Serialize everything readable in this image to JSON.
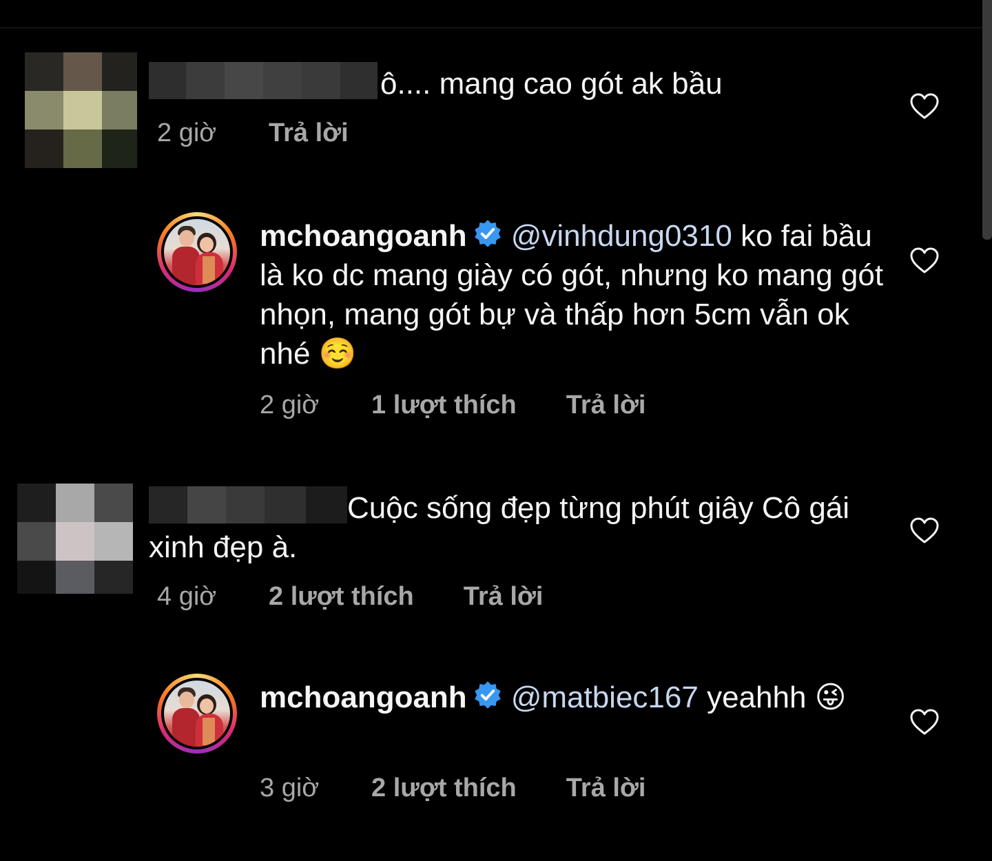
{
  "comments": [
    {
      "text": "ô.... mang cao gót ak bầu",
      "time": "2 giờ",
      "reply": "Trả lời",
      "reply_to": {
        "username": "mchoangoanh",
        "mention": "@vinhdung0310",
        "text": " ko fai bầu là ko dc mang giày có gót, nhưng ko mang gót nhọn, mang gót bự và thấp hơn 5cm vẫn ok nhé ☺️",
        "time": "2 giờ",
        "likes": "1 lượt thích",
        "reply": "Trả lời"
      }
    },
    {
      "text": "Cuộc sống đẹp từng phút giây Cô gái xinh đẹp à.",
      "time": "4 giờ",
      "likes": "2 lượt thích",
      "reply": "Trả lời",
      "reply_to": {
        "username": "mchoangoanh",
        "mention": "@matbiec167",
        "text": " yeahhh 😜",
        "time": "3 giờ",
        "likes": "2 lượt thích",
        "reply": "Trả lời"
      }
    }
  ],
  "icons": {
    "like": "heart-outline-icon",
    "verified": "verified-badge-icon"
  },
  "colors": {
    "background": "#000000",
    "text": "#f5f5f5",
    "secondary": "#a8a8a8",
    "verified": "#3897f0"
  }
}
